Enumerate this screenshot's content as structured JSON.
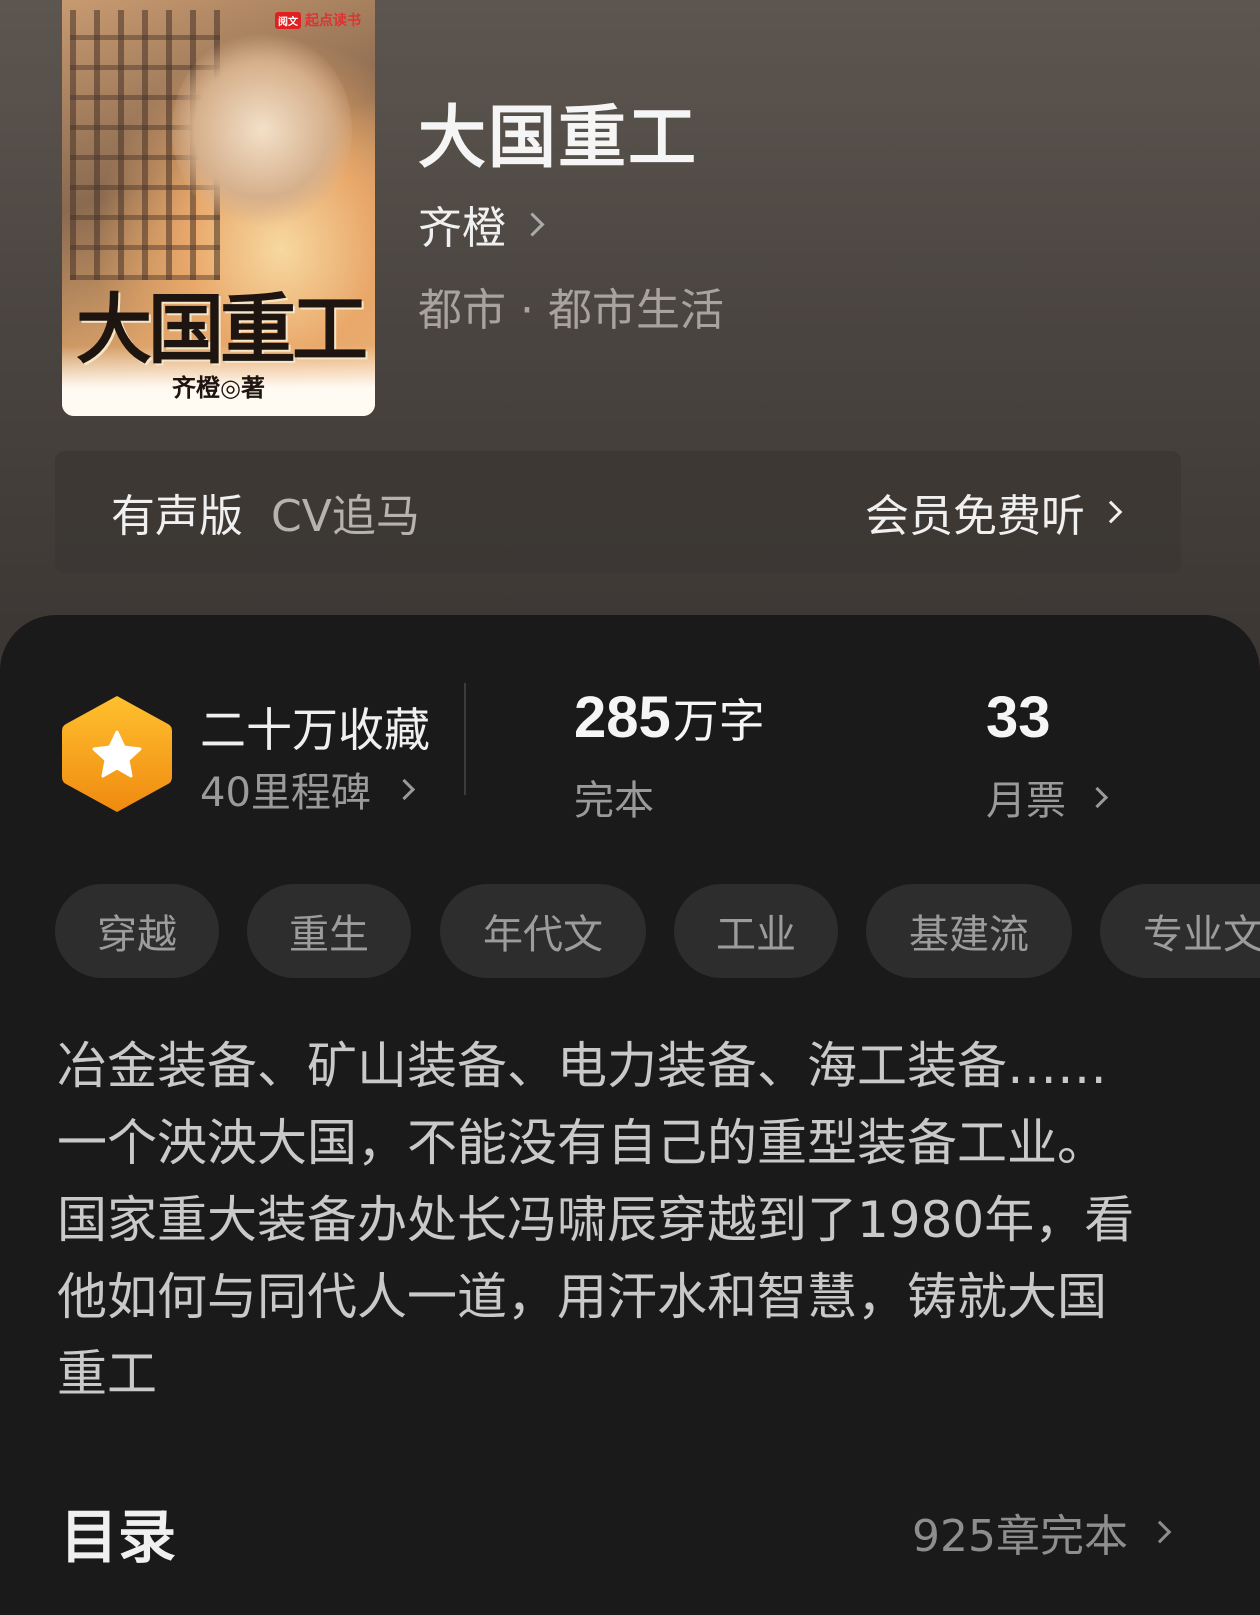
{
  "cover": {
    "brand": "起点读书",
    "brand_badge": "阅文",
    "title": "大国重工",
    "author_line": "齐橙◎著"
  },
  "book": {
    "title": "大国重工",
    "author": "齐橙",
    "category": "都市 · 都市生活"
  },
  "audio": {
    "label": "有声版",
    "cv": "CV追马",
    "cta": "会员免费听"
  },
  "stats": {
    "collect_main": "二十万收藏",
    "collect_sub": "40里程碑",
    "words_num": "285",
    "words_unit": "万字",
    "words_sub": "完本",
    "votes_num": "33",
    "votes_sub": "月票"
  },
  "tags": [
    "穿越",
    "重生",
    "年代文",
    "工业",
    "基建流",
    "专业文"
  ],
  "intro": [
    "冶金装备、矿山装备、电力装备、海工装备……",
    "一个泱泱大国，不能没有自己的重型装备工业。",
    "国家重大装备办处长冯啸辰穿越到了1980年，看",
    "他如何与同代人一道，用汗水和智慧，铸就大国",
    "重工"
  ],
  "toc": {
    "title": "目录",
    "status": "925章完本"
  },
  "colors": {
    "badge_orange": "#f7a51c",
    "panel_bg": "#1a1a1a",
    "tag_bg": "#2d2d2d"
  }
}
